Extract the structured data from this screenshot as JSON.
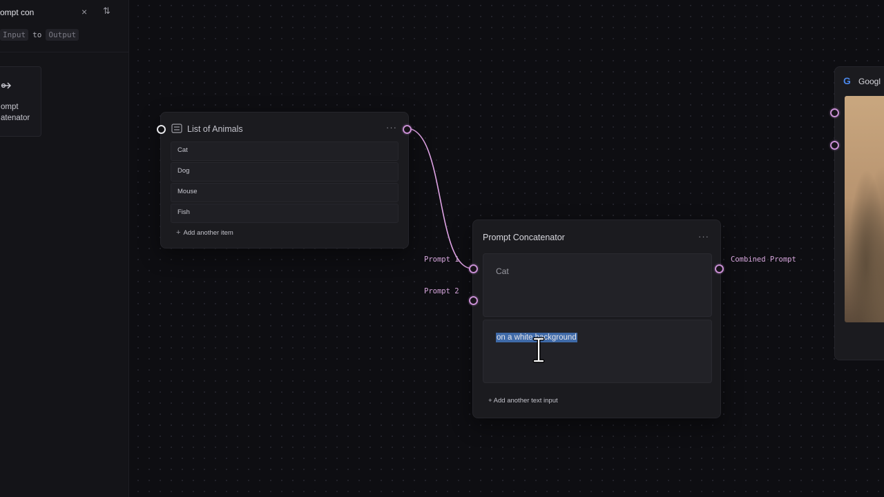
{
  "sidebar": {
    "search_value": "ompt con",
    "io_from": "Input",
    "io_to": "to",
    "io_output": "Output",
    "card": {
      "label": "ompt\natenator",
      "icon": "concat-arrow-icon"
    },
    "clear_icon": "×",
    "sort_icon": "⇅"
  },
  "list_node": {
    "title": "List of Animals",
    "menu_glyph": "···",
    "items": [
      {
        "label": "Cat"
      },
      {
        "label": "Dog"
      },
      {
        "label": "Mouse"
      },
      {
        "label": "Fish"
      }
    ],
    "add_item_label": "Add another item"
  },
  "concat_node": {
    "title": "Prompt Concatenator",
    "menu_glyph": "···",
    "input_labels": [
      "Prompt 1",
      "Prompt 2"
    ],
    "output_label": "Combined Prompt",
    "text_inputs": [
      "Cat",
      "on a white background"
    ],
    "add_text_label": "+ Add another text input"
  },
  "google_node": {
    "title": "Googl",
    "icon": "google-logo-icon"
  },
  "colors": {
    "wire": "#e0a4e6",
    "port_border": "#c98fd4",
    "selection": "#3f6aa8"
  }
}
